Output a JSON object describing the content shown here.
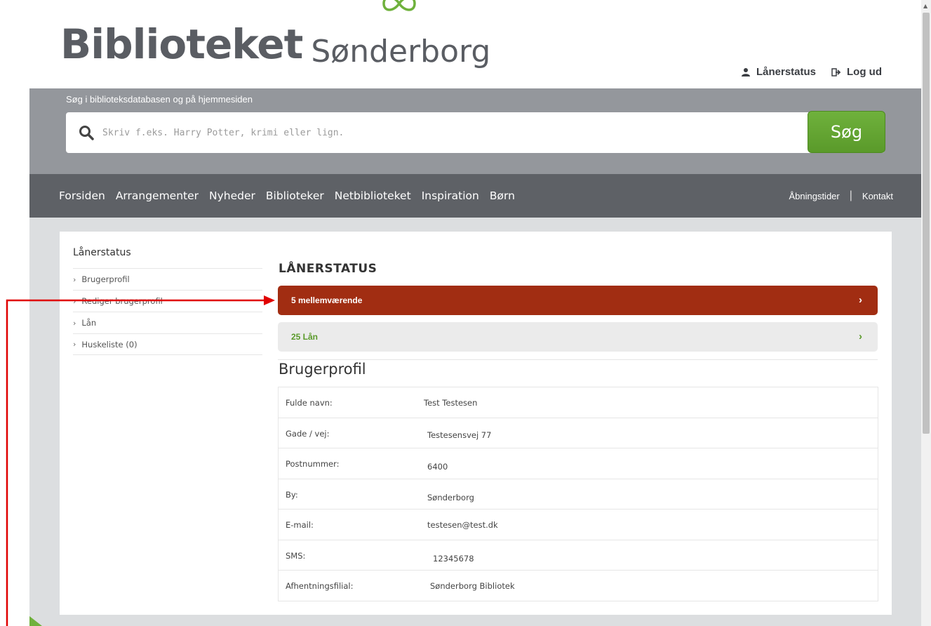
{
  "header": {
    "logo_main": "Biblioteket",
    "logo_sub": "Sønderborg",
    "links": [
      {
        "label": "Lånerstatus",
        "icon": "user-icon"
      },
      {
        "label": "Log ud",
        "icon": "logout-icon"
      }
    ]
  },
  "search": {
    "label": "Søg i biblioteksdatabasen og på hjemmesiden",
    "placeholder": "Skriv f.eks. Harry Potter, krimi eller lign.",
    "button": "Søg"
  },
  "nav": {
    "items": [
      "Forsiden",
      "Arrangementer",
      "Nyheder",
      "Biblioteker",
      "Netbiblioteket",
      "Inspiration",
      "Børn"
    ],
    "right": [
      "Åbningstider",
      "Kontakt"
    ]
  },
  "sidebar": {
    "title": "Lånerstatus",
    "items": [
      "Brugerprofil",
      "Rediger brugerprofil",
      "Lån",
      "Huskeliste (0)"
    ]
  },
  "main": {
    "title": "LÅNERSTATUS",
    "accordion": [
      {
        "label": "5 mellemværende",
        "style": "alert"
      },
      {
        "label": "25 Lån",
        "style": "normal"
      }
    ],
    "profile_title": "Brugerprofil",
    "profile": [
      {
        "label": "Fulde navn:",
        "value": "Test Testesen"
      },
      {
        "label": "Gade / vej:",
        "value": "Testesensvej 77"
      },
      {
        "label": "Postnummer:",
        "value": "6400"
      },
      {
        "label": "By:",
        "value": "Sønderborg"
      },
      {
        "label": "E-mail:",
        "value": "testesen@test.dk"
      },
      {
        "label": "SMS:",
        "value": "12345678"
      },
      {
        "label": "Afhentningsfilial:",
        "value": "Sønderborg Bibliotek"
      }
    ]
  },
  "colors": {
    "search_band": "#94979c",
    "nav": "#5e6166",
    "alert": "#a12d12",
    "accent_green": "#6fb13c",
    "annotation": "#e00000"
  }
}
